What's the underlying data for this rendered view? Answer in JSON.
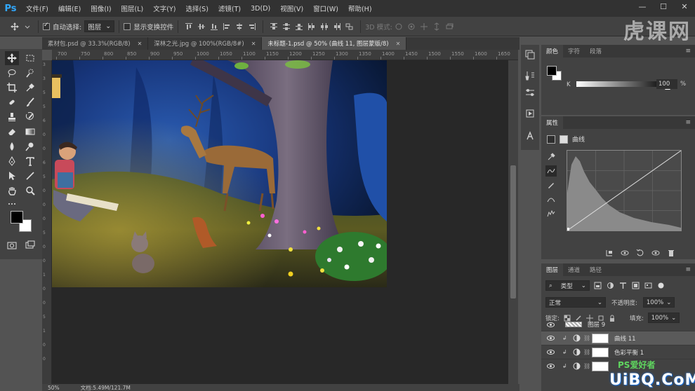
{
  "app": {
    "logo": "Ps"
  },
  "menu": [
    "文件(F)",
    "编辑(E)",
    "图像(I)",
    "图层(L)",
    "文字(Y)",
    "选择(S)",
    "滤镜(T)",
    "3D(D)",
    "视图(V)",
    "窗口(W)",
    "帮助(H)"
  ],
  "window_controls": {
    "minimize": "—",
    "maximize": "☐",
    "close": "✕"
  },
  "options": {
    "auto_select_label": "自动选择:",
    "auto_select_value": "图层",
    "show_transform_label": "显示变换控件",
    "mode_3d_label": "3D 模式:"
  },
  "watermark_top": "虎课网",
  "tabs": [
    {
      "label": "素材包.psd @ 33.3%(RGB/8)",
      "close": "✕"
    },
    {
      "label": "深林之光.jpg @ 100%(RGB/8#)",
      "close": "✕"
    },
    {
      "label": "未标题-1.psd @ 50% (曲线 11, 图层蒙版/8)",
      "close": "✕"
    }
  ],
  "ruler_h": [
    "700",
    "750",
    "800",
    "850",
    "900",
    "950",
    "1000",
    "1050",
    "1100",
    "1150",
    "1200",
    "1250",
    "1300",
    "1350",
    "1400",
    "1450",
    "1500",
    "1550",
    "1600",
    "1650"
  ],
  "ruler_v": [
    "3",
    "3",
    "5",
    "5",
    "6",
    "0",
    "0",
    "6",
    "5",
    "0",
    "0",
    "0",
    "5",
    "0",
    "0",
    "1",
    "0",
    "0",
    "5",
    "1",
    "0",
    "0"
  ],
  "status": {
    "zoom": "50%",
    "doc": "文档:5.49M/121.7M"
  },
  "color_panel": {
    "tabs": [
      "颜色",
      "字符",
      "段落"
    ],
    "k_label": "K",
    "k_value": "100",
    "k_unit": "%",
    "k_level": 1.0
  },
  "properties": {
    "tab": "属性",
    "title": "曲线"
  },
  "layers": {
    "tabs": [
      "图层",
      "通道",
      "路径"
    ],
    "filter_type": "类型",
    "blend_mode": "正常",
    "opacity_label": "不透明度:",
    "opacity_value": "100%",
    "lock_label": "锁定:",
    "fill_label": "填充:",
    "fill_value": "100%",
    "items": [
      {
        "name": "图层 9",
        "kind": "group"
      },
      {
        "name": "曲线 11",
        "kind": "curves",
        "selected": true
      },
      {
        "name": "色彩平衡 1",
        "kind": "balance"
      },
      {
        "name": "",
        "kind": "levels"
      }
    ]
  },
  "watermark_bottom": "UiBQ.CoM",
  "watermark_bottom_green": "PS爱好者"
}
